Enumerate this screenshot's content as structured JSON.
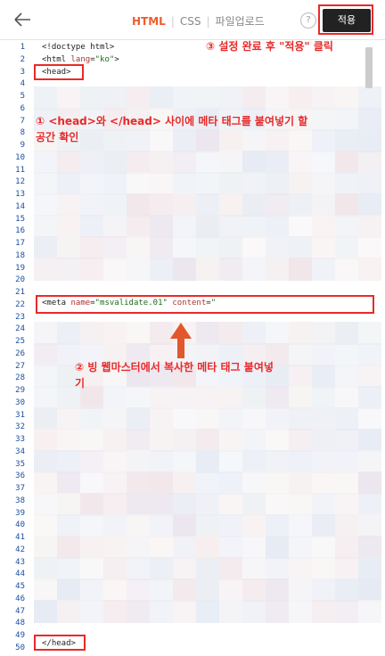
{
  "topbar": {
    "tabs": [
      "HTML",
      "CSS",
      "파일업로드"
    ],
    "active_tab": "HTML",
    "help": "?",
    "apply_label": "적용"
  },
  "editor": {
    "lines": {
      "l1": "<!doctype html>",
      "l2_pre": "<html ",
      "l2_attr": "lang",
      "l2_eq": "=",
      "l2_val": "\"ko\"",
      "l2_post": ">",
      "l3": "<head>",
      "l22_pre": "<meta ",
      "l22_attr1": "name",
      "l22_eq1": "=",
      "l22_val1": "\"msvalidate.01\"",
      "l22_attr2": "content",
      "l22_eq2": "=",
      "l22_val2": "\"",
      "l50": "</head>"
    },
    "line_numbers": [
      "1",
      "2",
      "3",
      "4",
      "5",
      "6",
      "7",
      "8",
      "9",
      "10",
      "11",
      "12",
      "13",
      "14",
      "15",
      "16",
      "17",
      "18",
      "19",
      "20",
      "21",
      "22",
      "23",
      "24",
      "25",
      "26",
      "27",
      "28",
      "29",
      "30",
      "31",
      "32",
      "33",
      "34",
      "35",
      "36",
      "37",
      "38",
      "39",
      "40",
      "41",
      "42",
      "43",
      "44",
      "45",
      "46",
      "47",
      "48",
      "49",
      "50"
    ]
  },
  "annotations": {
    "step3": "③ 설정 완료 후 \"적용\" 클릭",
    "step1_line1": "① <head>와 </head> 사이에 메타 태그를 붙여넣기 할",
    "step1_line2": "공간 확인",
    "step2_line1": "② 빙 웹마스터에서 복사한 메타 태그 붙여넣",
    "step2_line2": "기"
  },
  "colors": {
    "accent": "#f25a2a",
    "annotation_red": "#e82a2a",
    "line_number": "#1a4d9e",
    "apply_button": "#222222"
  },
  "icons": {
    "back": "back-arrow-icon",
    "help": "help-icon",
    "arrow": "up-arrow-icon"
  }
}
